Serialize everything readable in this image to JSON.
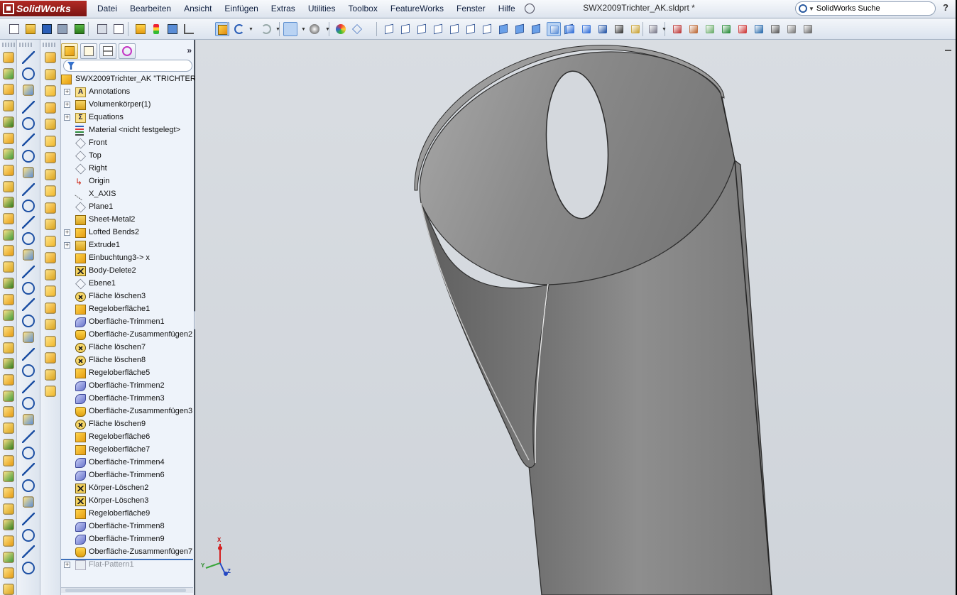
{
  "app": {
    "brand": "SolidWorks",
    "document_title": "SWX2009Trichter_AK.sldprt *",
    "search_placeholder": "SolidWorks Suche",
    "help_label": "?"
  },
  "menu": [
    "Datei",
    "Bearbeiten",
    "Ansicht",
    "Einfügen",
    "Extras",
    "Utilities",
    "Toolbox",
    "FeatureWorks",
    "Fenster",
    "Hilfe"
  ],
  "feature_manager": {
    "more_label": "»",
    "tabs": [
      "featuremanager-tab",
      "propertymanager-tab",
      "configurationmanager-tab",
      "dimxpert-tab"
    ],
    "root": "SWX2009Trichter_AK \"TRICHTER\"",
    "items": [
      {
        "label": "Annotations",
        "icon": "annotations-icon",
        "expandable": true
      },
      {
        "label": "Volumenkörper(1)",
        "icon": "solid-bodies-icon",
        "expandable": true
      },
      {
        "label": "Equations",
        "icon": "equations-icon",
        "expandable": true
      },
      {
        "label": "Material <nicht festgelegt>",
        "icon": "material-icon",
        "expandable": false
      },
      {
        "label": "Front",
        "icon": "plane-icon",
        "expandable": false
      },
      {
        "label": "Top",
        "icon": "plane-icon",
        "expandable": false
      },
      {
        "label": "Right",
        "icon": "plane-icon",
        "expandable": false
      },
      {
        "label": "Origin",
        "icon": "origin-icon",
        "expandable": false
      },
      {
        "label": "X_AXIS",
        "icon": "axis-icon",
        "expandable": false
      },
      {
        "label": "Plane1",
        "icon": "plane-icon",
        "expandable": false
      },
      {
        "label": "Sheet-Metal2",
        "icon": "sheet-metal-icon",
        "expandable": false
      },
      {
        "label": "Lofted Bends2",
        "icon": "lofted-bend-icon",
        "expandable": true
      },
      {
        "label": "Extrude1",
        "icon": "extrude-icon",
        "expandable": true
      },
      {
        "label": "Einbuchtung3-> x",
        "icon": "indent-icon",
        "expandable": false
      },
      {
        "label": "Body-Delete2",
        "icon": "body-delete-icon",
        "expandable": false
      },
      {
        "label": "Ebene1",
        "icon": "plane-feature-icon",
        "expandable": false
      },
      {
        "label": "Fläche löschen3",
        "icon": "delete-face-icon",
        "expandable": false
      },
      {
        "label": "Regeloberfläche1",
        "icon": "ruled-surface-icon",
        "expandable": false
      },
      {
        "label": "Oberfläche-Trimmen1",
        "icon": "trim-surface-icon",
        "expandable": false
      },
      {
        "label": "Oberfläche-Zusammenfügen2",
        "icon": "knit-surface-icon",
        "expandable": false
      },
      {
        "label": "Fläche löschen7",
        "icon": "delete-face-icon",
        "expandable": false
      },
      {
        "label": "Fläche löschen8",
        "icon": "delete-face-icon",
        "expandable": false
      },
      {
        "label": "Regeloberfläche5",
        "icon": "ruled-surface-icon",
        "expandable": false
      },
      {
        "label": "Oberfläche-Trimmen2",
        "icon": "trim-surface-icon",
        "expandable": false
      },
      {
        "label": "Oberfläche-Trimmen3",
        "icon": "trim-surface-icon",
        "expandable": false
      },
      {
        "label": "Oberfläche-Zusammenfügen3",
        "icon": "knit-surface-icon",
        "expandable": false
      },
      {
        "label": "Fläche löschen9",
        "icon": "delete-face-icon",
        "expandable": false
      },
      {
        "label": "Regeloberfläche6",
        "icon": "ruled-surface-icon",
        "expandable": false
      },
      {
        "label": "Regeloberfläche7",
        "icon": "ruled-surface-icon",
        "expandable": false
      },
      {
        "label": "Oberfläche-Trimmen4",
        "icon": "trim-surface-icon",
        "expandable": false
      },
      {
        "label": "Oberfläche-Trimmen6",
        "icon": "trim-surface-icon",
        "expandable": false
      },
      {
        "label": "Körper-Löschen2",
        "icon": "body-delete-icon",
        "expandable": false
      },
      {
        "label": "Körper-Löschen3",
        "icon": "body-delete-icon",
        "expandable": false
      },
      {
        "label": "Regeloberfläche9",
        "icon": "ruled-surface-icon",
        "expandable": false
      },
      {
        "label": "Oberfläche-Trimmen8",
        "icon": "trim-surface-icon",
        "expandable": false
      },
      {
        "label": "Oberfläche-Trimmen9",
        "icon": "trim-surface-icon",
        "expandable": false
      },
      {
        "label": "Oberfläche-Zusammenfügen7",
        "icon": "knit-surface-icon",
        "expandable": false
      },
      {
        "label": "Flat-Pattern1",
        "icon": "flat-pattern-icon",
        "expandable": true,
        "suppressed": true
      }
    ]
  },
  "triad": {
    "x": "X",
    "y": "Y",
    "z": "Z"
  },
  "colors": {
    "brand_red": "#9b1f1a",
    "viewport_bg": "#d5d9de",
    "part_outer": "#7d7d7d",
    "part_inner": "#8c8c8c",
    "feature_yellow": "#f0b72a",
    "selection_blue": "#b9d3f3"
  }
}
